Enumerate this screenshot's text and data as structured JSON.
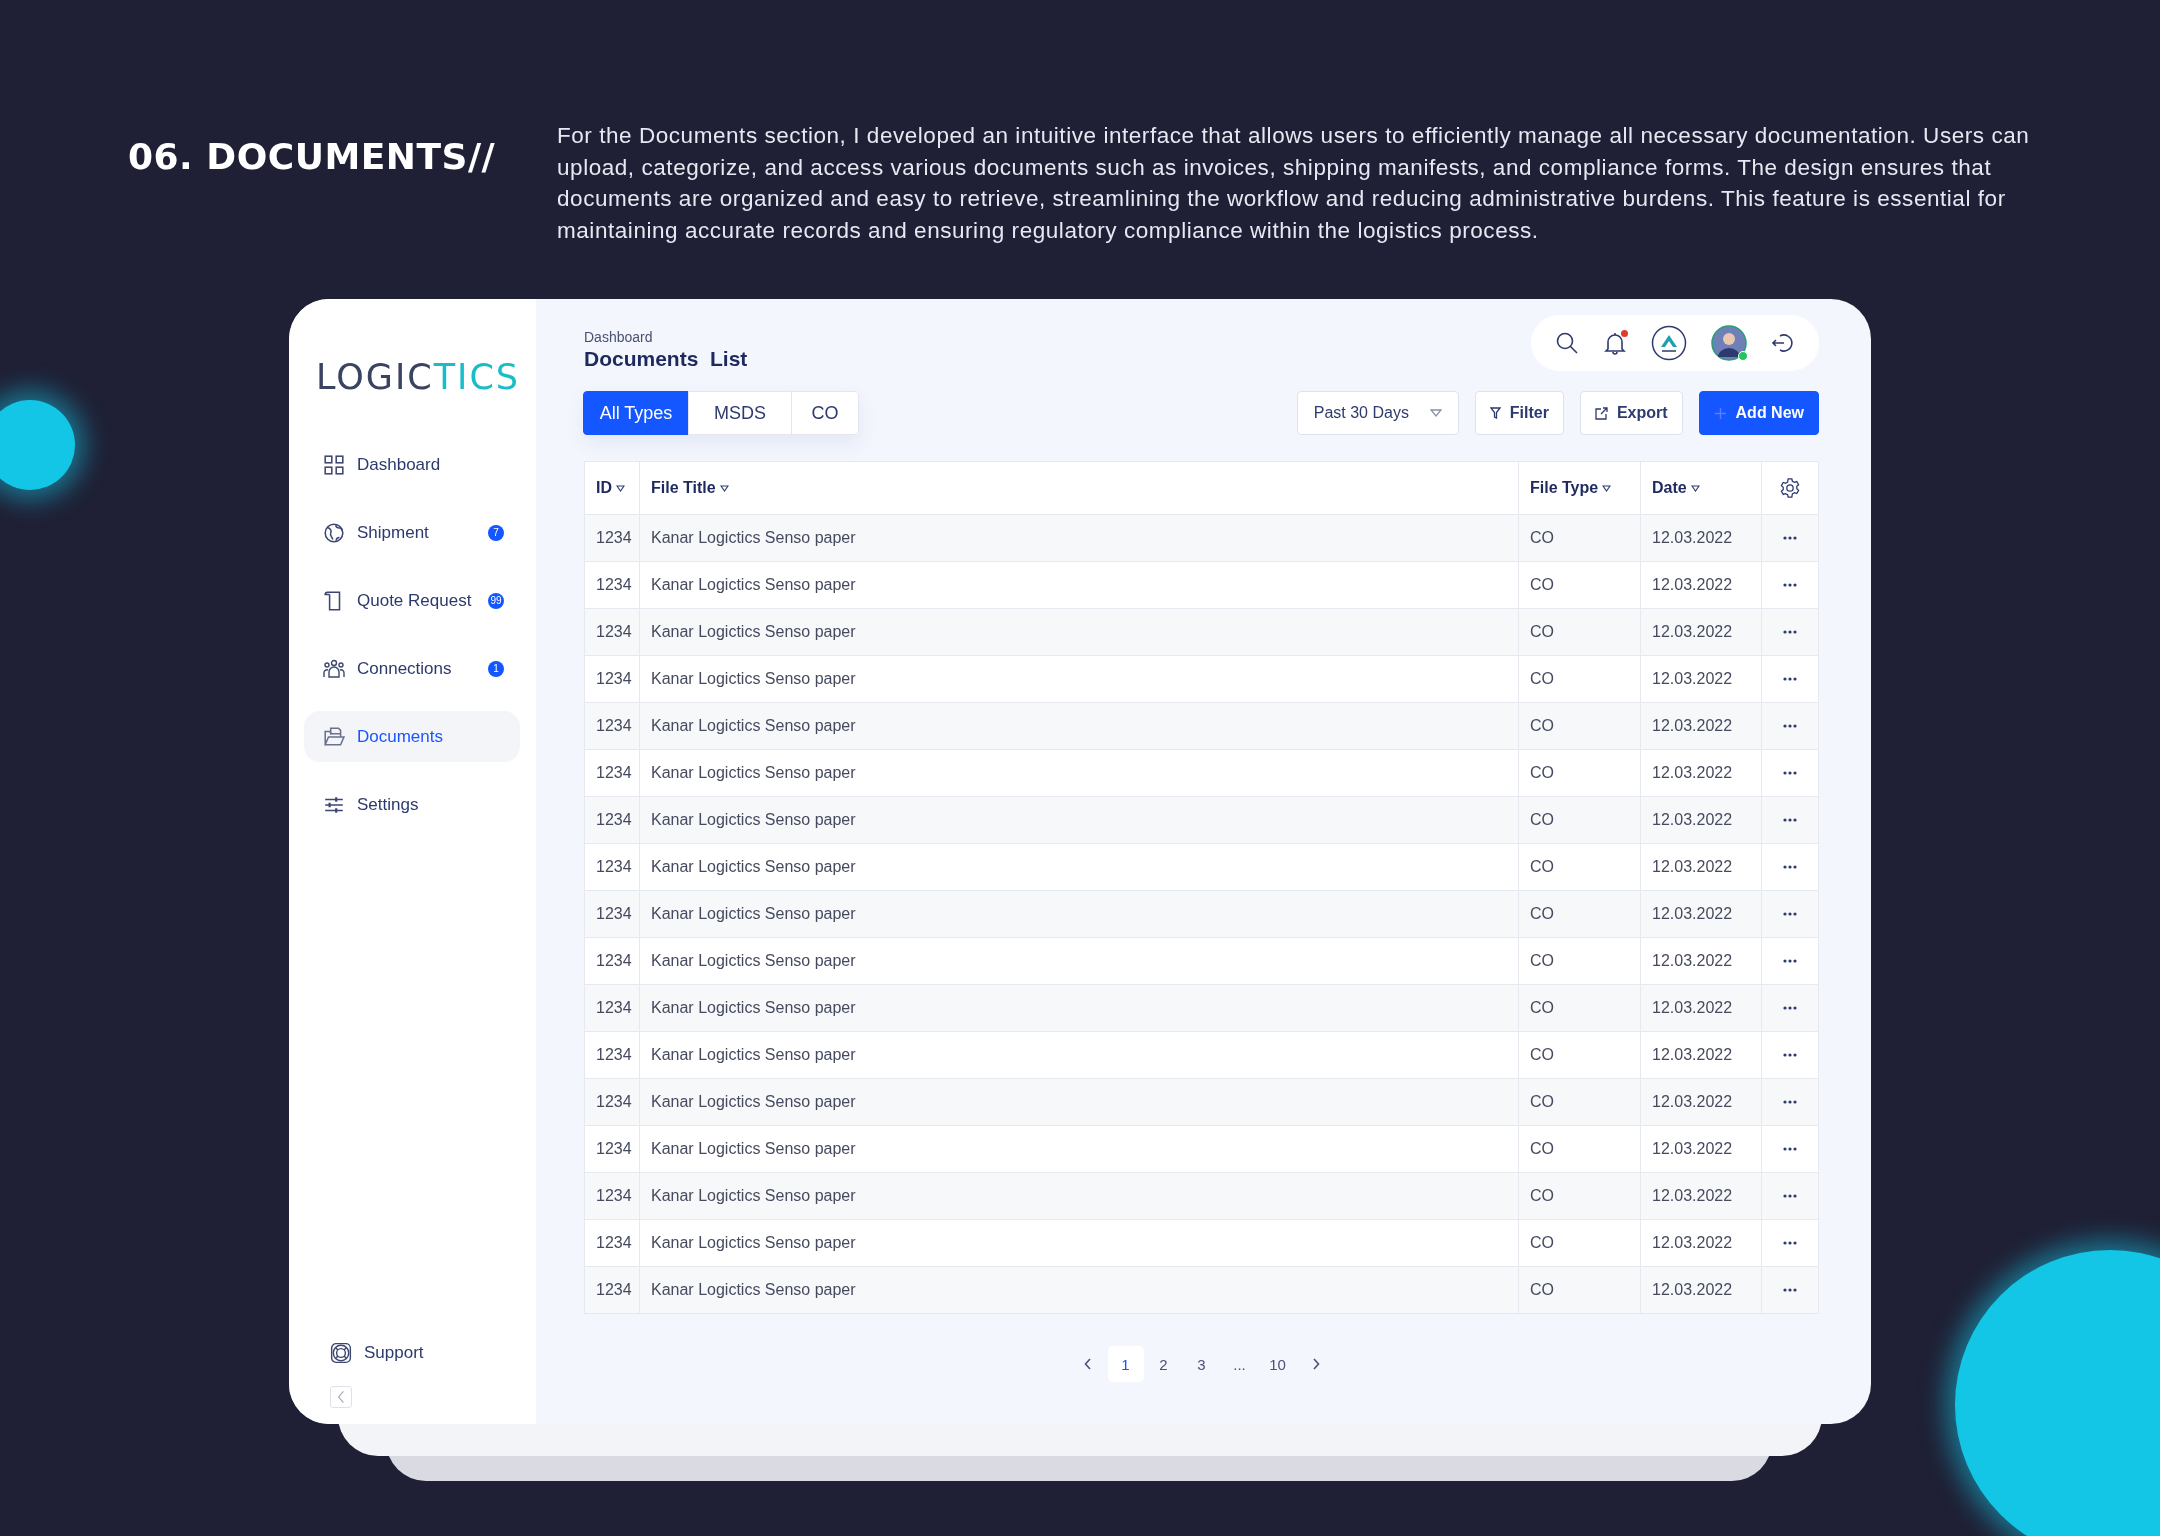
{
  "section": {
    "title": "06. DOCUMENTS//",
    "description": "For the Documents section, I developed an intuitive interface that allows users to efficiently manage all necessary documentation. Users can upload, categorize, and access various documents such as invoices, shipping manifests, and compliance forms. The design ensures that documents are organized and easy to retrieve, streamlining the workflow and reducing administrative burdens. This feature is essential for maintaining accurate records and ensuring regulatory compliance within the logistics process."
  },
  "app": {
    "logo": {
      "dark": "LOGIC",
      "accent": "TICS"
    },
    "nav": [
      {
        "label": "Dashboard",
        "selected": false
      },
      {
        "label": "Shipment",
        "badge": "7",
        "selected": false
      },
      {
        "label": "Quote Request",
        "badge": "99",
        "selected": false
      },
      {
        "label": "Connections",
        "badge": "1",
        "selected": false
      },
      {
        "label": "Documents",
        "selected": true
      },
      {
        "label": "Settings",
        "selected": false
      }
    ],
    "support": "Support",
    "breadcrumb": "Dashboard",
    "title": "Documents  List",
    "header": {
      "has_notification": true,
      "online": true
    },
    "type_tabs": [
      {
        "label": "All Types",
        "selected": true
      },
      {
        "label": "MSDS",
        "selected": false
      },
      {
        "label": "CO",
        "selected": false
      }
    ],
    "period": "Past 30 Days",
    "filter_button": "Filter",
    "export_button": "Export",
    "add_button": "Add New",
    "table": {
      "columns": [
        "ID",
        "File Title",
        "File Type",
        "Date"
      ],
      "rows": [
        {
          "id": "1234",
          "title": "Kanar Logictics Senso paper",
          "type": "CO",
          "date": "12.03.2022"
        },
        {
          "id": "1234",
          "title": "Kanar Logictics Senso paper",
          "type": "CO",
          "date": "12.03.2022"
        },
        {
          "id": "1234",
          "title": "Kanar Logictics Senso paper",
          "type": "CO",
          "date": "12.03.2022"
        },
        {
          "id": "1234",
          "title": "Kanar Logictics Senso paper",
          "type": "CO",
          "date": "12.03.2022"
        },
        {
          "id": "1234",
          "title": "Kanar Logictics Senso paper",
          "type": "CO",
          "date": "12.03.2022"
        },
        {
          "id": "1234",
          "title": "Kanar Logictics Senso paper",
          "type": "CO",
          "date": "12.03.2022"
        },
        {
          "id": "1234",
          "title": "Kanar Logictics Senso paper",
          "type": "CO",
          "date": "12.03.2022"
        },
        {
          "id": "1234",
          "title": "Kanar Logictics Senso paper",
          "type": "CO",
          "date": "12.03.2022"
        },
        {
          "id": "1234",
          "title": "Kanar Logictics Senso paper",
          "type": "CO",
          "date": "12.03.2022"
        },
        {
          "id": "1234",
          "title": "Kanar Logictics Senso paper",
          "type": "CO",
          "date": "12.03.2022"
        },
        {
          "id": "1234",
          "title": "Kanar Logictics Senso paper",
          "type": "CO",
          "date": "12.03.2022"
        },
        {
          "id": "1234",
          "title": "Kanar Logictics Senso paper",
          "type": "CO",
          "date": "12.03.2022"
        },
        {
          "id": "1234",
          "title": "Kanar Logictics Senso paper",
          "type": "CO",
          "date": "12.03.2022"
        },
        {
          "id": "1234",
          "title": "Kanar Logictics Senso paper",
          "type": "CO",
          "date": "12.03.2022"
        },
        {
          "id": "1234",
          "title": "Kanar Logictics Senso paper",
          "type": "CO",
          "date": "12.03.2022"
        },
        {
          "id": "1234",
          "title": "Kanar Logictics Senso paper",
          "type": "CO",
          "date": "12.03.2022"
        },
        {
          "id": "1234",
          "title": "Kanar Logictics Senso paper",
          "type": "CO",
          "date": "12.03.2022"
        }
      ]
    },
    "pagination": [
      {
        "label": "1",
        "selected": true
      },
      {
        "label": "2",
        "selected": false
      },
      {
        "label": "3",
        "selected": false
      },
      {
        "label": "...",
        "selected": false
      },
      {
        "label": "10",
        "selected": false
      }
    ]
  }
}
